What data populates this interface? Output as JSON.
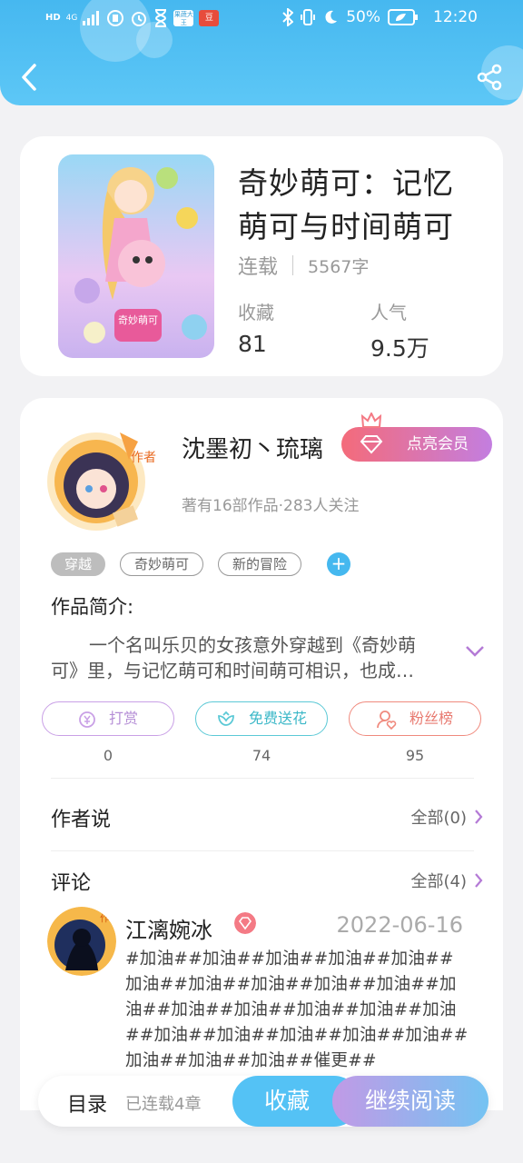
{
  "status_bar": {
    "battery": "50%",
    "time": "12:20",
    "network": "4G",
    "hd": "HD"
  },
  "book": {
    "title": "奇妙萌可：记忆萌可与时间萌可",
    "status": "连载",
    "word_count": "5567字",
    "favorites_label": "收藏",
    "favorites_value": "81",
    "popularity_label": "人气",
    "popularity_value": "9.5万",
    "cover_logo_text": "奇妙萌可"
  },
  "author": {
    "name": "沈墨初丶琉璃",
    "vip_label": "点亮会员",
    "meta": "著有16部作品·283人关注",
    "avatar_tag": "作者"
  },
  "tags": [
    "穿越",
    "奇妙萌可",
    "新的冒险"
  ],
  "intro": {
    "heading": "作品简介:",
    "text": "一个名叫乐贝的女孩意外穿越到《奇妙萌可》里，与记忆萌可和时间萌可相识，也成…"
  },
  "actions": [
    {
      "label": "打赏",
      "count": "0"
    },
    {
      "label": "免费送花",
      "count": "74"
    },
    {
      "label": "粉丝榜",
      "count": "95"
    }
  ],
  "author_says": {
    "heading": "作者说",
    "more": "全部(0)"
  },
  "comments": {
    "heading": "评论",
    "more": "全部(4)",
    "item": {
      "user": "江漓婉冰",
      "date": "2022-06-16",
      "text": "#加油##加油##加油##加油##加油##加油##加油##加油##加油##加油##加油##加油##加油##加油##加油##加油##加油##加油##加油##加油##加油##加油##加油##加油##催更##",
      "avatar_tag": "作者"
    }
  },
  "bottom_bar": {
    "directory": "目录",
    "chapters": "已连载4章",
    "favorite": "收藏",
    "continue": "继续阅读"
  },
  "colors": {
    "header": "#46b8f0",
    "accent_blue": "#54c2f5",
    "vip_pink": "#f46b7a",
    "vip_purple": "#c37ee0",
    "reward_purple": "#c9a0e6",
    "flower_cyan": "#5cc9d6",
    "fans_red": "#f08a7e"
  }
}
